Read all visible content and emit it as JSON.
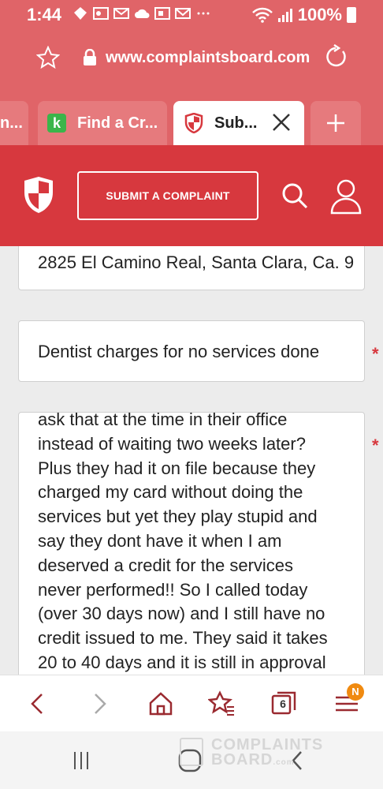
{
  "status_bar": {
    "time": "1:44",
    "battery": "100%",
    "notification_icons": [
      "gallery-icon",
      "outlook-icon",
      "mail-icon",
      "cloud-icon",
      "office-icon",
      "gmail-icon",
      "more-icon"
    ]
  },
  "browser": {
    "url": "www.complaintsboard.com",
    "tabs": [
      {
        "label": "n..."
      },
      {
        "label": "Find a Cr..."
      },
      {
        "label": "Sub..."
      }
    ],
    "tab_count": "6",
    "menu_badge": "N"
  },
  "site": {
    "submit_label": "SUBMIT A COMPLAINT"
  },
  "form": {
    "address_value": "2825 El Camino Real, Santa Clara, Ca. 9",
    "title_value": "Dentist charges for no services done",
    "required_mark": "*",
    "description_lines": [
      "ask that at the time in their office",
      "instead of waiting two weeks later?",
      "Plus they had it on file because they",
      "charged my card without doing the",
      "services but yet they play stupid and",
      "say they dont have it when I am",
      "deserved a credit for the services",
      "never performed!! So I called today",
      "(over 30 days now) and I still have no",
      "credit issued to me. They said it takes",
      "20 to 40 days and it is still in approval"
    ]
  },
  "watermark": {
    "line1": "COMPLAINTS",
    "line2": "BOARD",
    "suffix": ".com"
  },
  "colors": {
    "brand_red": "#d7383e",
    "chrome_red": "#e06468",
    "badge_orange": "#f08a10"
  }
}
